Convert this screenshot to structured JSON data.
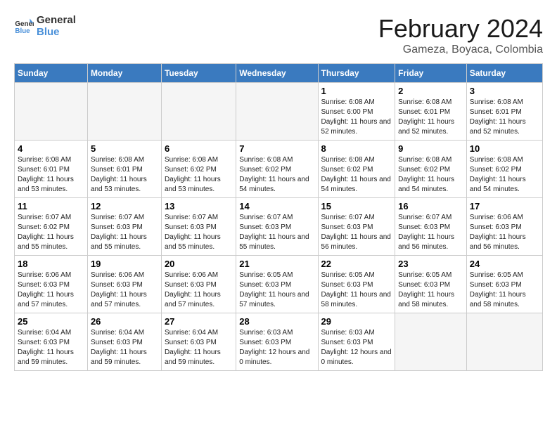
{
  "logo": {
    "line1": "General",
    "line2": "Blue"
  },
  "title": "February 2024",
  "location": "Gameza, Boyaca, Colombia",
  "days_of_week": [
    "Sunday",
    "Monday",
    "Tuesday",
    "Wednesday",
    "Thursday",
    "Friday",
    "Saturday"
  ],
  "weeks": [
    [
      {
        "num": "",
        "empty": true
      },
      {
        "num": "",
        "empty": true
      },
      {
        "num": "",
        "empty": true
      },
      {
        "num": "",
        "empty": true
      },
      {
        "num": "1",
        "sunrise": "6:08 AM",
        "sunset": "6:00 PM",
        "daylight": "11 hours and 52 minutes."
      },
      {
        "num": "2",
        "sunrise": "6:08 AM",
        "sunset": "6:01 PM",
        "daylight": "11 hours and 52 minutes."
      },
      {
        "num": "3",
        "sunrise": "6:08 AM",
        "sunset": "6:01 PM",
        "daylight": "11 hours and 52 minutes."
      }
    ],
    [
      {
        "num": "4",
        "sunrise": "6:08 AM",
        "sunset": "6:01 PM",
        "daylight": "11 hours and 53 minutes."
      },
      {
        "num": "5",
        "sunrise": "6:08 AM",
        "sunset": "6:01 PM",
        "daylight": "11 hours and 53 minutes."
      },
      {
        "num": "6",
        "sunrise": "6:08 AM",
        "sunset": "6:02 PM",
        "daylight": "11 hours and 53 minutes."
      },
      {
        "num": "7",
        "sunrise": "6:08 AM",
        "sunset": "6:02 PM",
        "daylight": "11 hours and 54 minutes."
      },
      {
        "num": "8",
        "sunrise": "6:08 AM",
        "sunset": "6:02 PM",
        "daylight": "11 hours and 54 minutes."
      },
      {
        "num": "9",
        "sunrise": "6:08 AM",
        "sunset": "6:02 PM",
        "daylight": "11 hours and 54 minutes."
      },
      {
        "num": "10",
        "sunrise": "6:08 AM",
        "sunset": "6:02 PM",
        "daylight": "11 hours and 54 minutes."
      }
    ],
    [
      {
        "num": "11",
        "sunrise": "6:07 AM",
        "sunset": "6:02 PM",
        "daylight": "11 hours and 55 minutes."
      },
      {
        "num": "12",
        "sunrise": "6:07 AM",
        "sunset": "6:03 PM",
        "daylight": "11 hours and 55 minutes."
      },
      {
        "num": "13",
        "sunrise": "6:07 AM",
        "sunset": "6:03 PM",
        "daylight": "11 hours and 55 minutes."
      },
      {
        "num": "14",
        "sunrise": "6:07 AM",
        "sunset": "6:03 PM",
        "daylight": "11 hours and 55 minutes."
      },
      {
        "num": "15",
        "sunrise": "6:07 AM",
        "sunset": "6:03 PM",
        "daylight": "11 hours and 56 minutes."
      },
      {
        "num": "16",
        "sunrise": "6:07 AM",
        "sunset": "6:03 PM",
        "daylight": "11 hours and 56 minutes."
      },
      {
        "num": "17",
        "sunrise": "6:06 AM",
        "sunset": "6:03 PM",
        "daylight": "11 hours and 56 minutes."
      }
    ],
    [
      {
        "num": "18",
        "sunrise": "6:06 AM",
        "sunset": "6:03 PM",
        "daylight": "11 hours and 57 minutes."
      },
      {
        "num": "19",
        "sunrise": "6:06 AM",
        "sunset": "6:03 PM",
        "daylight": "11 hours and 57 minutes."
      },
      {
        "num": "20",
        "sunrise": "6:06 AM",
        "sunset": "6:03 PM",
        "daylight": "11 hours and 57 minutes."
      },
      {
        "num": "21",
        "sunrise": "6:05 AM",
        "sunset": "6:03 PM",
        "daylight": "11 hours and 57 minutes."
      },
      {
        "num": "22",
        "sunrise": "6:05 AM",
        "sunset": "6:03 PM",
        "daylight": "11 hours and 58 minutes."
      },
      {
        "num": "23",
        "sunrise": "6:05 AM",
        "sunset": "6:03 PM",
        "daylight": "11 hours and 58 minutes."
      },
      {
        "num": "24",
        "sunrise": "6:05 AM",
        "sunset": "6:03 PM",
        "daylight": "11 hours and 58 minutes."
      }
    ],
    [
      {
        "num": "25",
        "sunrise": "6:04 AM",
        "sunset": "6:03 PM",
        "daylight": "11 hours and 59 minutes."
      },
      {
        "num": "26",
        "sunrise": "6:04 AM",
        "sunset": "6:03 PM",
        "daylight": "11 hours and 59 minutes."
      },
      {
        "num": "27",
        "sunrise": "6:04 AM",
        "sunset": "6:03 PM",
        "daylight": "11 hours and 59 minutes."
      },
      {
        "num": "28",
        "sunrise": "6:03 AM",
        "sunset": "6:03 PM",
        "daylight": "12 hours and 0 minutes."
      },
      {
        "num": "29",
        "sunrise": "6:03 AM",
        "sunset": "6:03 PM",
        "daylight": "12 hours and 0 minutes."
      },
      {
        "num": "",
        "empty": true
      },
      {
        "num": "",
        "empty": true
      }
    ]
  ],
  "labels": {
    "sunrise": "Sunrise:",
    "sunset": "Sunset:",
    "daylight": "Daylight:"
  }
}
